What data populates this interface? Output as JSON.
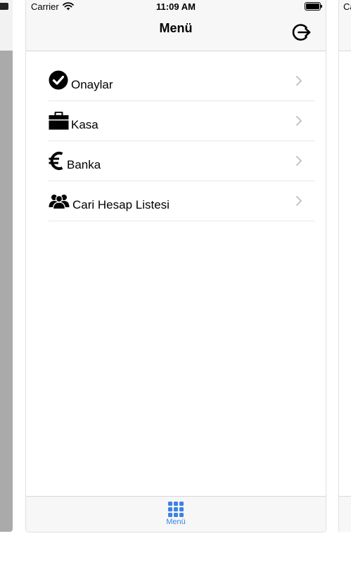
{
  "status_bar": {
    "carrier": "Carrier",
    "time": "11:09 AM"
  },
  "right_preview": {
    "carrier": "Ca"
  },
  "nav": {
    "title": "Menü",
    "logout_icon": "logout-icon"
  },
  "menu": {
    "items": [
      {
        "label": "Onaylar",
        "icon": "check-circle-icon"
      },
      {
        "label": "Kasa",
        "icon": "briefcase-icon"
      },
      {
        "label": "Banka",
        "icon": "euro-icon"
      },
      {
        "label": "Cari Hesap Listesi",
        "icon": "users-icon"
      }
    ]
  },
  "tabbar": {
    "items": [
      {
        "label": "Menü",
        "icon": "grid-icon",
        "active": true
      }
    ]
  },
  "colors": {
    "accent": "#3b83e6",
    "bar_background": "#f7f7f7",
    "separator": "#e6e6e6",
    "chevron": "#c4c4c9"
  }
}
